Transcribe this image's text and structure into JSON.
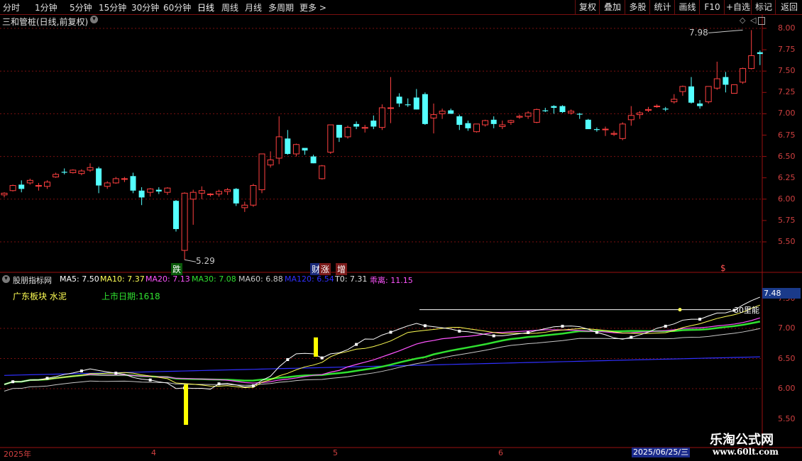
{
  "toolbar": {
    "periods": [
      "分时",
      "1分钟",
      "5分钟",
      "15分钟",
      "30分钟",
      "60分钟",
      "日线",
      "周线",
      "月线",
      "多周期",
      "更多 >"
    ],
    "active_period": "日线",
    "right_buttons": [
      "复权",
      "叠加",
      "多股",
      "统计",
      "画线",
      "F10",
      "+自选",
      "标记",
      "返回"
    ]
  },
  "stock": {
    "title": "三和管桩(日线,前复权)",
    "high_label": "7.98",
    "low_label": "5.29"
  },
  "price_axis": [
    "8.00",
    "7.75",
    "7.50",
    "7.25",
    "7.00",
    "6.75",
    "6.50",
    "6.25",
    "6.00",
    "5.75",
    "5.50"
  ],
  "markers": {
    "fall": "跌",
    "finance": "财",
    "rise": "涨",
    "increase": "增",
    "dollar": "$"
  },
  "indicator": {
    "name": "股朋指标网",
    "ma5": "MA5: 7.50",
    "ma10": "MA10: 7.37",
    "ma20": "MA20: 7.13",
    "ma30": "MA30: 7.08",
    "ma60": "MA60: 6.88",
    "ma120": "MA120: 6.54",
    "t0": "T0: 7.31",
    "deviation": "乖离: 11.15",
    "sector": "广东板块  水泥",
    "listing": "上市日期:1618",
    "current_value": "7.48",
    "line_label": "30里能"
  },
  "indicator_axis": [
    "7.50",
    "7.00",
    "6.50",
    "6.00",
    "5.50"
  ],
  "dates": {
    "year": "2025年",
    "m4": "4",
    "m5": "5",
    "m6": "6",
    "cursor_date": "2025/06/25/三"
  },
  "watermark": {
    "text": "乐淘公式网",
    "url": "www.60lt.com"
  },
  "colors": {
    "up": "#ff4040",
    "down": "#54ffff",
    "ma5": "#ffffff",
    "ma10": "#ffff54",
    "ma20": "#ff54ff",
    "ma30": "#30e030",
    "ma60": "#c8c8c8",
    "ma120": "#3030ff"
  },
  "candles": [
    [
      6.05,
      6.08,
      6.02,
      6.07
    ],
    [
      6.1,
      6.17,
      6.09,
      6.16
    ],
    [
      6.17,
      6.22,
      6.08,
      6.12
    ],
    [
      6.19,
      6.24,
      6.17,
      6.22
    ],
    [
      6.16,
      6.19,
      6.1,
      6.16
    ],
    [
      6.15,
      6.22,
      6.12,
      6.2
    ],
    [
      6.26,
      6.31,
      6.25,
      6.29
    ],
    [
      6.32,
      6.36,
      6.29,
      6.31
    ],
    [
      6.31,
      6.35,
      6.3,
      6.34
    ],
    [
      6.3,
      6.35,
      6.28,
      6.33
    ],
    [
      6.34,
      6.42,
      6.32,
      6.37
    ],
    [
      6.36,
      6.38,
      6.07,
      6.16
    ],
    [
      6.15,
      6.21,
      6.12,
      6.19
    ],
    [
      6.19,
      6.26,
      6.18,
      6.24
    ],
    [
      6.24,
      6.26,
      6.2,
      6.24
    ],
    [
      6.27,
      6.31,
      6.07,
      6.1
    ],
    [
      6.1,
      6.14,
      5.93,
      6.02
    ],
    [
      6.08,
      6.13,
      6.03,
      6.12
    ],
    [
      6.11,
      6.14,
      6.06,
      6.09
    ],
    [
      6.08,
      6.14,
      6.05,
      6.13
    ],
    [
      5.98,
      5.99,
      5.62,
      5.65
    ],
    [
      5.4,
      6.08,
      5.29,
      6.07
    ],
    [
      6.0,
      6.11,
      5.7,
      6.08
    ],
    [
      6.07,
      6.15,
      6.0,
      6.1
    ],
    [
      6.06,
      6.07,
      6.03,
      6.06
    ],
    [
      6.06,
      6.11,
      6.03,
      6.09
    ],
    [
      6.09,
      6.13,
      6.05,
      6.11
    ],
    [
      6.12,
      6.13,
      5.92,
      5.95
    ],
    [
      5.9,
      5.97,
      5.85,
      5.93
    ],
    [
      5.93,
      6.18,
      5.91,
      6.16
    ],
    [
      6.11,
      6.53,
      6.07,
      6.53
    ],
    [
      6.4,
      6.56,
      6.37,
      6.46
    ],
    [
      6.48,
      6.97,
      6.41,
      6.73
    ],
    [
      6.71,
      6.81,
      6.52,
      6.53
    ],
    [
      6.53,
      6.65,
      6.5,
      6.64
    ],
    [
      6.6,
      6.58,
      6.52,
      6.57
    ],
    [
      6.5,
      6.52,
      6.42,
      6.42
    ],
    [
      6.24,
      6.4,
      6.23,
      6.39
    ],
    [
      6.55,
      6.86,
      6.53,
      6.87
    ],
    [
      6.87,
      6.86,
      6.67,
      6.72
    ],
    [
      6.73,
      6.86,
      6.71,
      6.84
    ],
    [
      6.88,
      6.91,
      6.82,
      6.85
    ],
    [
      6.83,
      6.87,
      6.78,
      6.84
    ],
    [
      6.92,
      6.98,
      6.82,
      6.85
    ],
    [
      6.84,
      7.11,
      6.81,
      7.07
    ],
    [
      7.07,
      7.43,
      6.89,
      7.07
    ],
    [
      7.2,
      7.24,
      7.08,
      7.12
    ],
    [
      7.11,
      7.18,
      7.08,
      7.1
    ],
    [
      7.19,
      7.29,
      7.05,
      7.05
    ],
    [
      7.23,
      7.25,
      6.87,
      6.88
    ],
    [
      6.95,
      7.12,
      6.77,
      6.99
    ],
    [
      7.0,
      7.06,
      6.94,
      7.03
    ],
    [
      7.04,
      7.06,
      7.0,
      7.0
    ],
    [
      6.97,
      6.99,
      6.81,
      6.87
    ],
    [
      6.89,
      6.92,
      6.8,
      6.83
    ],
    [
      6.79,
      6.88,
      6.78,
      6.88
    ],
    [
      6.87,
      6.93,
      6.85,
      6.92
    ],
    [
      6.93,
      6.97,
      6.83,
      6.88
    ],
    [
      6.85,
      6.92,
      6.82,
      6.87
    ],
    [
      6.9,
      6.93,
      6.87,
      6.92
    ],
    [
      6.96,
      6.99,
      6.94,
      6.97
    ],
    [
      6.97,
      7.03,
      6.94,
      7.01
    ],
    [
      6.9,
      7.06,
      6.89,
      7.05
    ],
    [
      7.04,
      7.07,
      7.02,
      7.03
    ],
    [
      7.09,
      7.1,
      7.0,
      7.07
    ],
    [
      7.09,
      7.1,
      7.01,
      7.02
    ],
    [
      7.01,
      7.05,
      6.99,
      7.03
    ],
    [
      7.0,
      7.01,
      6.94,
      6.99
    ],
    [
      6.93,
      6.94,
      6.84,
      6.82
    ],
    [
      6.82,
      6.84,
      6.79,
      6.81
    ],
    [
      6.82,
      6.85,
      6.74,
      6.82
    ],
    [
      6.76,
      6.8,
      6.74,
      6.77
    ],
    [
      6.71,
      6.9,
      6.69,
      6.88
    ],
    [
      6.93,
      7.09,
      6.86,
      6.98
    ],
    [
      6.99,
      7.03,
      6.94,
      7.01
    ],
    [
      7.04,
      7.08,
      7.02,
      7.05
    ],
    [
      7.09,
      7.11,
      7.07,
      7.09
    ],
    [
      7.06,
      7.08,
      7.03,
      7.05
    ],
    [
      7.14,
      7.23,
      7.12,
      7.17
    ],
    [
      7.26,
      7.33,
      7.21,
      7.32
    ],
    [
      7.32,
      7.43,
      7.12,
      7.13
    ],
    [
      7.12,
      7.16,
      7.06,
      7.09
    ],
    [
      7.14,
      7.19,
      7.12,
      7.32
    ],
    [
      7.3,
      7.61,
      7.28,
      7.41
    ],
    [
      7.43,
      7.49,
      7.25,
      7.34
    ],
    [
      7.24,
      7.34,
      7.25,
      7.34
    ],
    [
      7.37,
      7.54,
      7.35,
      7.53
    ],
    [
      7.53,
      7.98,
      7.52,
      7.68
    ],
    [
      7.72,
      7.74,
      7.57,
      7.7
    ]
  ]
}
